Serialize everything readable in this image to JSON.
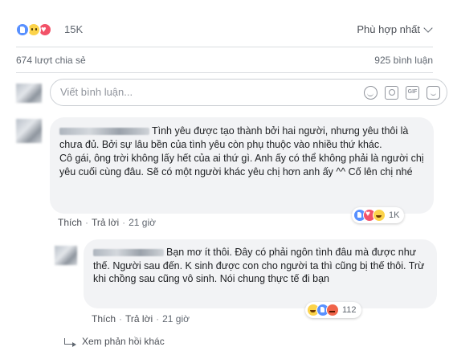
{
  "reactions": {
    "icons": [
      "like-icon",
      "sad-icon",
      "love-icon"
    ],
    "count": "15K",
    "sort_label": "Phù hợp nhất"
  },
  "stats": {
    "shares": "674 lượt chia sẻ",
    "comments": "925 bình luận"
  },
  "composer": {
    "placeholder": "Viết bình luận...",
    "icons": [
      "camera-icon",
      "smile-icon",
      "gif-icon",
      "sticker-icon"
    ]
  },
  "comments": [
    {
      "text": "Tình yêu được tạo thành bởi hai người, nhưng yêu thôi là chưa đủ. Bởi sự lâu bền của tình yêu còn phụ thuộc vào nhiều thứ khác.",
      "text2": "Cô gái, ông trời không lấy hết của ai thứ gì. Anh ấy có thể không phải là người chị yêu cuối cùng đâu. Sẽ có một người khác yêu chị hơn anh ấy ^^ Cố lên chị nhé",
      "like_label": "Thích",
      "reply_label": "Trả lời",
      "time": "21 giờ",
      "reaction_icons": [
        "like-icon",
        "love-icon",
        "haha-icon"
      ],
      "reaction_count": "1K"
    },
    {
      "text": "Bạn mơ ít thôi. Đây có phải ngôn tình đâu mà được như thế. Người sau đến. K sinh được con cho người ta thì cũng bị thế thôi. Trừ khi chồng sau cũng vô sinh. Nói chung thực tế đi bạn",
      "like_label": "Thích",
      "reply_label": "Trả lời",
      "time": "21 giờ",
      "reaction_icons": [
        "haha-icon",
        "like-icon",
        "angry-icon"
      ],
      "reaction_count": "112"
    }
  ],
  "more_replies": "Xem phản hồi khác",
  "colors": {
    "like": "#5890ff",
    "love": "#f25268",
    "haha": "#fcd34a",
    "angry": "#f0644a",
    "bubble": "#f2f3f5"
  }
}
